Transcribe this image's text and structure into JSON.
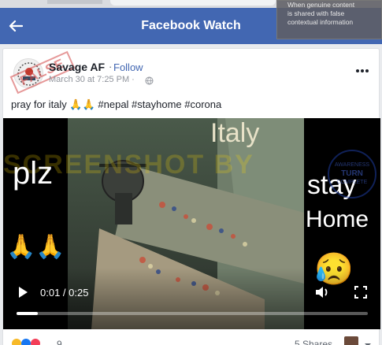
{
  "header": {
    "title": "Facebook Watch",
    "back_icon": "back-arrow-icon",
    "bg_color": "#4267b2"
  },
  "fact_check_overlay": {
    "lines": [
      "When genuine content",
      "is shared with false",
      "contextual information"
    ]
  },
  "post": {
    "author": "Savage AF",
    "separator": "·",
    "follow_label": "Follow",
    "timestamp": "March 30 at 7:25 PM ·",
    "privacy_icon": "globe-icon",
    "stamp_text": "FALSE",
    "caption_text": "pray for italy ",
    "caption_emoji": "🙏🙏",
    "caption_tags": " #nepal #stayhome #corona",
    "more_icon": "more-dots-icon"
  },
  "video": {
    "overlay_text_left": "plz",
    "overlay_text_top": "Italy",
    "overlay_text_right_1": "stay",
    "overlay_text_right_2": "Home",
    "emoji_left": "🙏🙏",
    "emoji_right": "😥",
    "badge_lines": [
      "AWARENESS",
      "TURN",
      "COMPLETE"
    ],
    "watermark_text": "SCREENSHOT BY",
    "current_time": "0:01",
    "duration": "0:25",
    "time_display": "0:01 / 0:25",
    "progress_percent": 6,
    "controls": {
      "play_icon": "play-icon",
      "volume_icon": "volume-icon",
      "fullscreen_icon": "fullscreen-icon"
    }
  },
  "footer": {
    "reaction_count": "9",
    "shares_label": "5 Shares"
  }
}
